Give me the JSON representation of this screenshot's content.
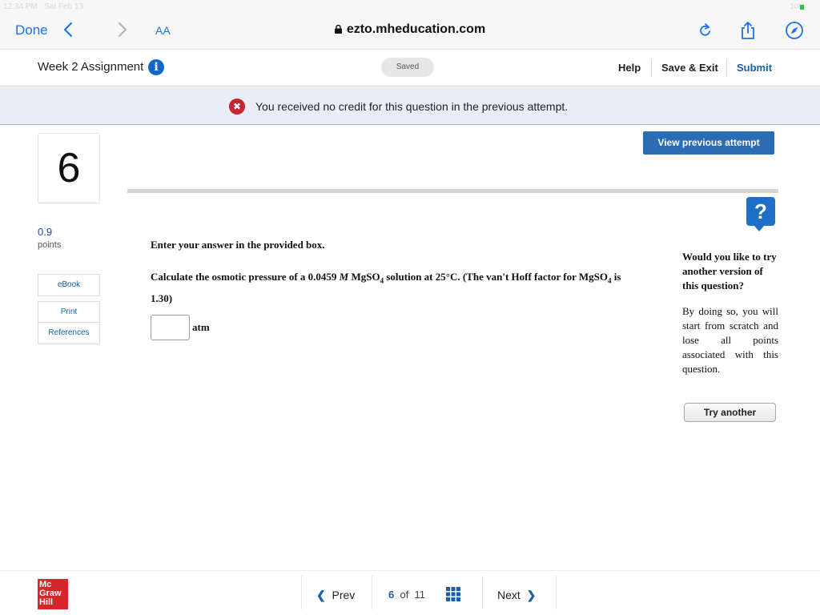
{
  "status_bar": {
    "time": "12:34 PM",
    "date": "Sat Feb 13",
    "battery": "10%"
  },
  "browser": {
    "done_label": "Done",
    "aa_label": "AA",
    "url": "ezto.mheducation.com"
  },
  "header": {
    "assignment_title": "Week 2 Assignment",
    "saved_label": "Saved",
    "help_label": "Help",
    "save_exit_label": "Save & Exit",
    "submit_label": "Submit"
  },
  "notice": {
    "text": "You received no credit for this question in the previous attempt."
  },
  "question_panel": {
    "number": "6",
    "points_value": "0.9",
    "points_label": "points",
    "links": [
      "eBook",
      "Print",
      "References"
    ]
  },
  "question": {
    "view_previous_label": "View previous attempt",
    "instruction": "Enter your answer in the provided box.",
    "text_part1": "Calculate the osmotic pressure of a 0.0459 ",
    "molarity_symbol": "M",
    "text_part2": " MgSO",
    "sub1": "4",
    "text_part3": " solution at 25°C. (The van't Hoff factor for MgSO",
    "sub2": "4",
    "text_part4": " is 1.30)",
    "answer_value": "",
    "answer_unit": "atm"
  },
  "try_another": {
    "question": "Would you like to try another version of this question?",
    "description": "By doing so, you will start from scratch and lose all points associated with this question.",
    "button_label": "Try another"
  },
  "footer": {
    "logo_lines": [
      "Mc",
      "Graw",
      "Hill"
    ],
    "prev_label": "Prev",
    "current_page": "6",
    "of_label": "of",
    "total_pages": "11",
    "next_label": "Next"
  },
  "colors": {
    "accent": "#1a5fa8",
    "error": "#c7262e",
    "logo": "#d6252b",
    "button": "#2a6db5"
  }
}
